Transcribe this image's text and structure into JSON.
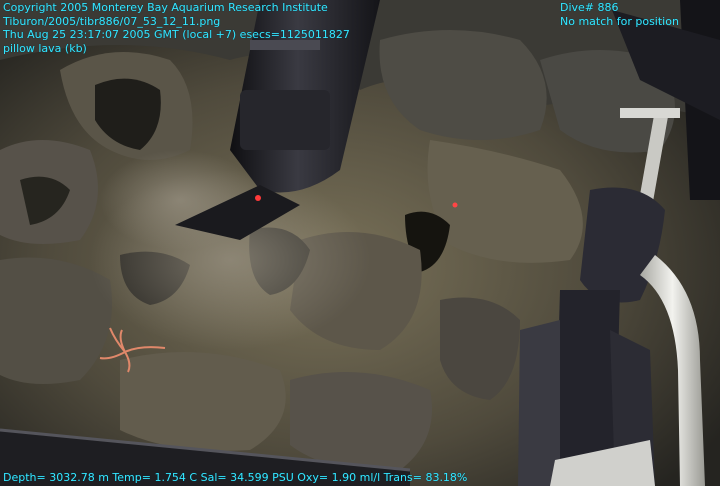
{
  "overlay": {
    "color": "#35e6ff",
    "top_left": [
      "Copyright 2005 Monterey Bay Aquarium Research Institute",
      "Tiburon/2005/tibr886/07_53_12_11.png",
      "Thu Aug 25 23:17:07 2005 GMT (local +7)  esecs=1125011827",
      "pillow lava (kb)"
    ],
    "top_right": [
      "Dive# 886",
      "No match for position"
    ],
    "bottom": "Depth= 3032.78 m  Temp= 1.754 C  Sal= 34.599 PSU  Oxy= 1.90 ml/l  Trans= 83.18%"
  },
  "scene": {
    "subject": "seafloor",
    "sediment_color": "#6b6450",
    "rock_color": "#4a4842",
    "arm_color": "#1c1c20",
    "hose_color": "#dcdcd6"
  }
}
